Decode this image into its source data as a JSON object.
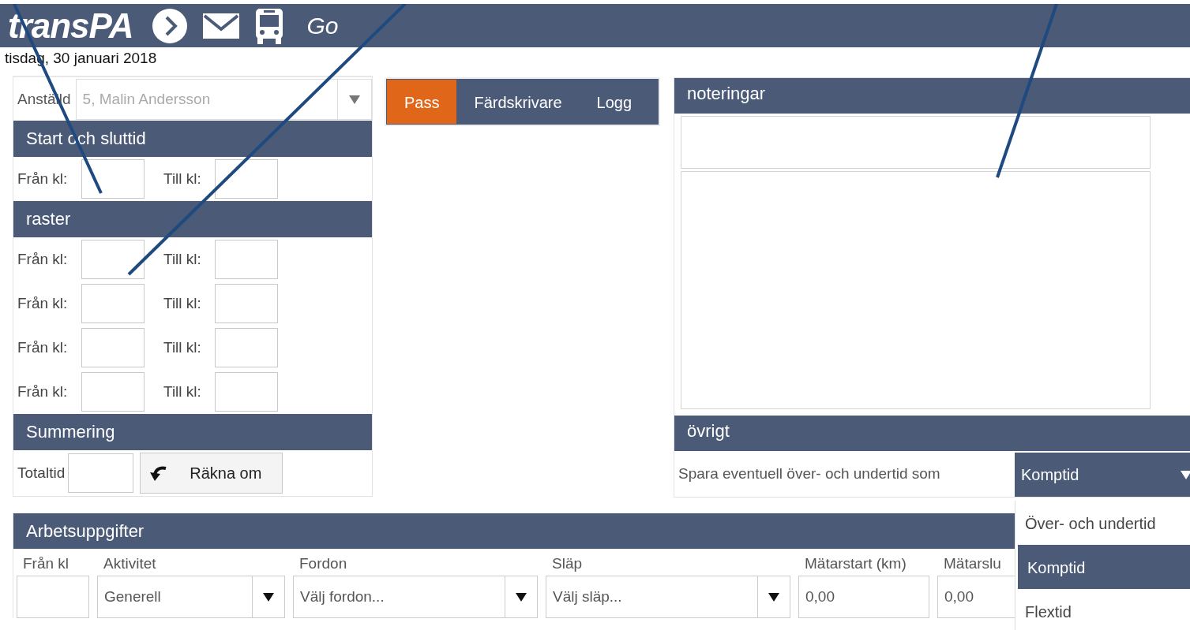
{
  "header": {
    "logo": "transPA",
    "go": "Go"
  },
  "date": "tisdag, 30 januari 2018",
  "employee": {
    "label": "Anställd",
    "value": "5, Malin Andersson",
    "disabled": true
  },
  "shift": {
    "title": "Start och sluttid",
    "rows": [
      {
        "from_label": "Från kl:",
        "to_label": "Till kl:"
      }
    ]
  },
  "breaks": {
    "title": "raster",
    "rows": [
      {
        "from_label": "Från kl:",
        "to_label": "Till kl:"
      },
      {
        "from_label": "Från kl:",
        "to_label": "Till kl:"
      },
      {
        "from_label": "Från kl:",
        "to_label": "Till kl:"
      },
      {
        "from_label": "Från kl:",
        "to_label": "Till kl:"
      }
    ]
  },
  "summary": {
    "title": "Summering",
    "label": "Totaltid",
    "button": "Räkna om"
  },
  "tabs": [
    {
      "label": "Pass",
      "selected": true
    },
    {
      "label": "Färdskrivare",
      "selected": false
    },
    {
      "label": "Logg",
      "selected": false
    }
  ],
  "notes": {
    "title": "noteringar"
  },
  "other": {
    "title": "övrigt",
    "text": "Spara eventuell över- och undertid som",
    "select": {
      "value": "Komptid",
      "expanded": true
    },
    "options": [
      {
        "label": "Över- och undertid",
        "selected": false
      },
      {
        "label": "Komptid",
        "selected": true
      },
      {
        "label": "Flextid",
        "selected": false
      }
    ]
  },
  "tasks": {
    "title": "Arbetsuppgifter",
    "columns": [
      {
        "label": "Från kl",
        "kind": "input"
      },
      {
        "label": "Aktivitet",
        "kind": "select",
        "value": "Generell"
      },
      {
        "label": "Fordon",
        "kind": "select",
        "value": "Välj fordon..."
      },
      {
        "label": "Släp",
        "kind": "select",
        "value": "Välj släp..."
      },
      {
        "label": "Mätarstart (km)",
        "kind": "input",
        "value": "0,00"
      },
      {
        "label": "Mätarslu",
        "kind": "input",
        "value": "0,00"
      }
    ]
  }
}
